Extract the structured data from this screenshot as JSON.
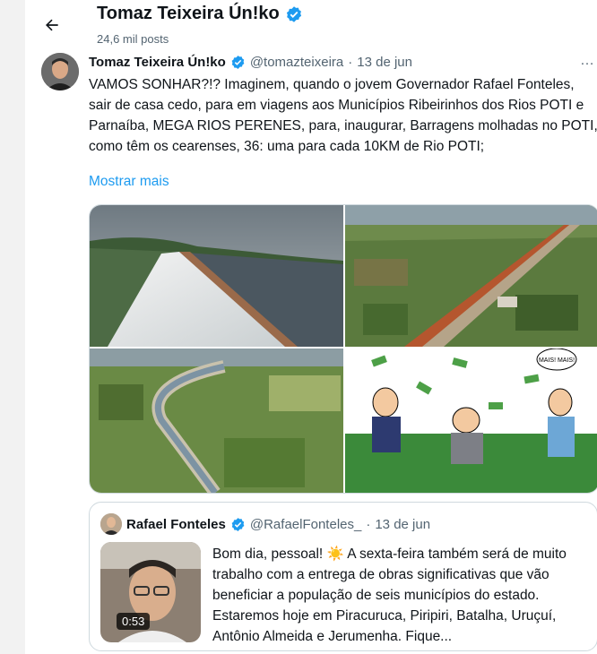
{
  "header": {
    "back_label": "Voltar",
    "title": "Tomaz Teixeira Ún!ko",
    "posts_count": "24,6 mil posts"
  },
  "post": {
    "author_name": "Tomaz Teixeira Ún!ko",
    "handle": "@tomazteixeira",
    "separator": "·",
    "date": "13 de jun",
    "more_icon": "…",
    "text": "VAMOS SONHAR?!? Imaginem, quando o jovem Governador Rafael Fonteles, sair de casa cedo, para em viagens aos Municípios Ribeirinhos dos Rios POTI e Parnaíba, MEGA RIOS PERENES, para, inaugurar, Barragens molhadas no POTI, como têm os cearenses, 36: uma para cada 10KM de Rio POTI;",
    "show_more": "Mostrar mais",
    "cartoon_bubble": "MAIS! MAIS!"
  },
  "quoted": {
    "author_name": "Rafael Fonteles",
    "handle": "@RafaelFonteles_",
    "separator": "·",
    "date": "13 de jun",
    "video_duration": "0:53",
    "text": "Bom dia, pessoal! ☀️ A sexta-feira também será de muito trabalho com a entrega de obras significativas que vão beneficiar a população de seis municípios do estado. Estaremos hoje em Piracuruca, Piripiri, Batalha, Uruçuí, Antônio Almeida e Jerumenha. Fique..."
  },
  "colors": {
    "verified": "#1d9bf0",
    "link": "#1d9bf0",
    "secondary_text": "#536471",
    "border": "#cfd9de"
  }
}
